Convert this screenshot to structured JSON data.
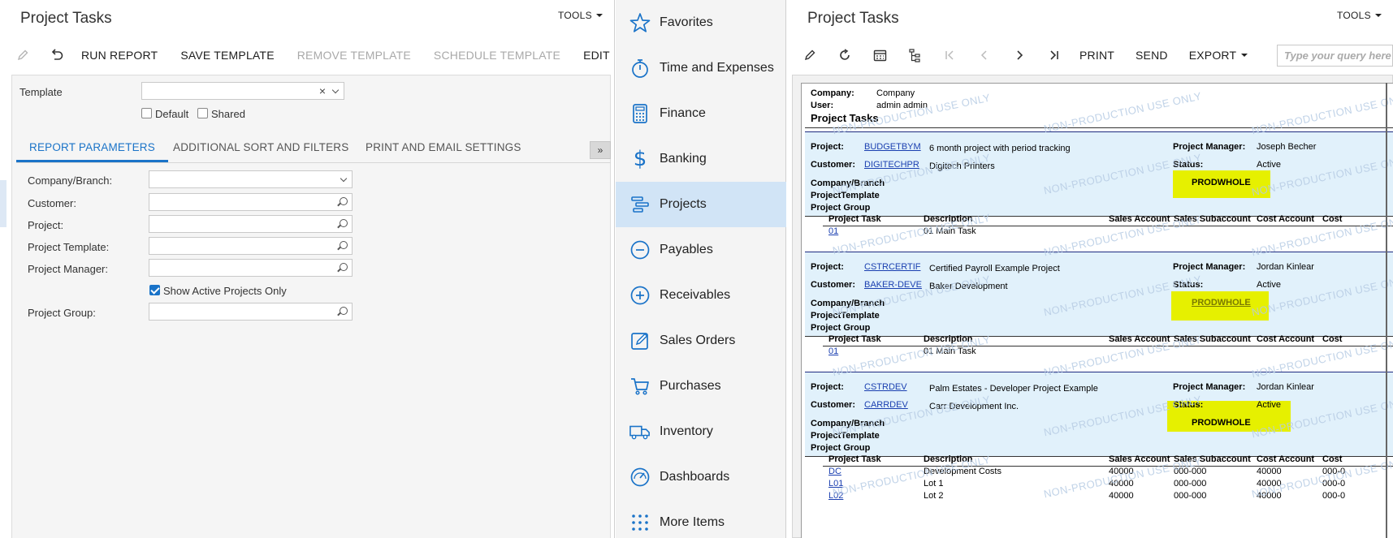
{
  "left": {
    "title": "Project Tasks",
    "tools": "TOOLS",
    "toolbar": {
      "run_report": "RUN REPORT",
      "save_template": "SAVE TEMPLATE",
      "remove_template": "REMOVE TEMPLATE",
      "schedule_template": "SCHEDULE TEMPLATE",
      "edit": "EDIT"
    },
    "template": {
      "label": "Template",
      "value": "",
      "default_label": "Default",
      "default_checked": false,
      "shared_label": "Shared",
      "shared_checked": false
    },
    "tabs": [
      "REPORT PARAMETERS",
      "ADDITIONAL SORT AND FILTERS",
      "PRINT AND EMAIL SETTINGS"
    ],
    "collapse_glyph": "»",
    "params": {
      "company_branch": "Company/Branch:",
      "customer": "Customer:",
      "project": "Project:",
      "project_template": "Project Template:",
      "project_manager": "Project Manager:",
      "show_active_label": "Show Active Projects Only",
      "show_active_checked": true,
      "project_group": "Project Group:"
    }
  },
  "nav": {
    "items": [
      {
        "label": "Favorites",
        "icon": "star-icon",
        "active": false
      },
      {
        "label": "Time and Expenses",
        "icon": "stopwatch-icon",
        "active": false
      },
      {
        "label": "Finance",
        "icon": "calculator-icon",
        "active": false
      },
      {
        "label": "Banking",
        "icon": "dollar-icon",
        "active": false
      },
      {
        "label": "Projects",
        "icon": "projects-icon",
        "active": true
      },
      {
        "label": "Payables",
        "icon": "minus-circle-icon",
        "active": false
      },
      {
        "label": "Receivables",
        "icon": "plus-circle-icon",
        "active": false
      },
      {
        "label": "Sales Orders",
        "icon": "edit-box-icon",
        "active": false
      },
      {
        "label": "Purchases",
        "icon": "cart-icon",
        "active": false
      },
      {
        "label": "Inventory",
        "icon": "truck-icon",
        "active": false
      },
      {
        "label": "Dashboards",
        "icon": "gauge-icon",
        "active": false
      },
      {
        "label": "More Items",
        "icon": "grid-dots-icon",
        "active": false
      }
    ],
    "accent_color": "#1a73c8"
  },
  "right": {
    "title": "Project Tasks",
    "tools": "TOOLS",
    "toolbar": {
      "print": "PRINT",
      "send": "SEND",
      "export": "EXPORT"
    },
    "search_placeholder": "Type your query here",
    "report": {
      "company_label": "Company:",
      "company_value": "Company",
      "user_label": "User:",
      "user_value": "admin admin",
      "heading": "Project Tasks",
      "watermark": "NON-PRODUCTION USE ONLY",
      "labels": {
        "project": "Project:",
        "customer": "Customer:",
        "company_branch": "Company/Branch",
        "project_template": "ProjectTemplate",
        "project_group": "Project Group",
        "project_manager": "Project Manager:",
        "status": "Status:"
      },
      "columns": [
        "Project Task",
        "Description",
        "Sales Account",
        "Sales Subaccount",
        "Cost Account",
        "Cost"
      ],
      "projects": [
        {
          "id": "BUDGETBYM",
          "description": "6 month project with period tracking",
          "customer_id": "DIGITECHPR",
          "customer_name": "Digitech Printers",
          "manager": "Joseph Becher",
          "status": "Active",
          "template": "PRODWHOLE",
          "tasks": [
            {
              "task": "01",
              "description": "01 Main Task",
              "sales_account": "",
              "sales_subaccount": "",
              "cost_account": "",
              "cost": ""
            }
          ]
        },
        {
          "id": "CSTRCERTIF",
          "description": "Certified Payroll Example Project",
          "customer_id": "BAKER-DEVE",
          "customer_name": "Baker Development",
          "manager": "Jordan Kinlear",
          "status": "Active",
          "template": "PRODWHOLE",
          "tasks": [
            {
              "task": "01",
              "description": "01 Main Task",
              "sales_account": "",
              "sales_subaccount": "",
              "cost_account": "",
              "cost": ""
            }
          ]
        },
        {
          "id": "CSTRDEV",
          "description": "Palm Estates - Developer Project Example",
          "customer_id": "CARRDEV",
          "customer_name": "Carr Development Inc.",
          "manager": "Jordan Kinlear",
          "status": "Active",
          "template": "PRODWHOLE",
          "tasks": [
            {
              "task": "DC",
              "description": "Development Costs",
              "sales_account": "40000",
              "sales_subaccount": "000-000",
              "cost_account": "40000",
              "cost": "000-0"
            },
            {
              "task": "L01",
              "description": "Lot 1",
              "sales_account": "40000",
              "sales_subaccount": "000-000",
              "cost_account": "40000",
              "cost": "000-0"
            },
            {
              "task": "L02",
              "description": "Lot 2",
              "sales_account": "40000",
              "sales_subaccount": "000-000",
              "cost_account": "40000",
              "cost": "000-0"
            }
          ]
        }
      ]
    }
  }
}
